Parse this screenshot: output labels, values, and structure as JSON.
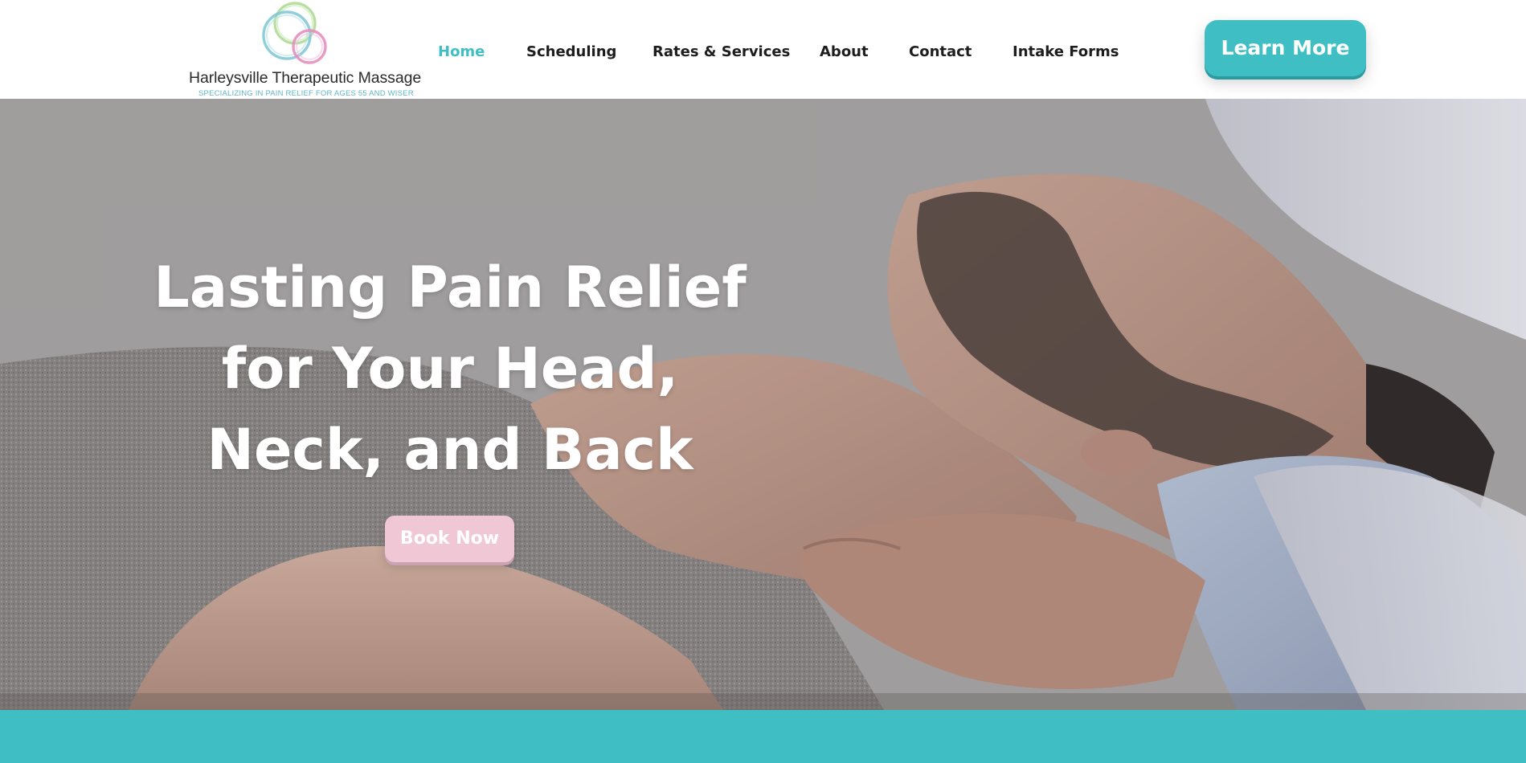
{
  "brand": {
    "name": "Harleysville Therapeutic Massage",
    "tagline": "SPECIALIZING IN PAIN RELIEF FOR AGES 55 AND WISER",
    "logo_icon": "overlapping-watercolor-rings-icon"
  },
  "nav": {
    "items": [
      {
        "label": "Home",
        "active": true
      },
      {
        "label": "Scheduling",
        "active": false
      },
      {
        "label": "Rates & Services",
        "active": false
      },
      {
        "label": "About",
        "active": false
      },
      {
        "label": "Contact",
        "active": false
      },
      {
        "label": "Intake Forms",
        "active": false
      }
    ],
    "cta_label": "Learn More"
  },
  "hero": {
    "title_lines": [
      "Lasting Pain Relief",
      "for Your Head,",
      "Neck, and Back"
    ],
    "cta_label": "Book Now",
    "image": "man-receiving-neck-massage-photo"
  },
  "colors": {
    "accent_teal": "#3fbfc3",
    "accent_pink": "#f0c8d5",
    "nav_text": "#1d1d1d",
    "ring_green": "#9fd38a",
    "ring_blue": "#7cc6d6",
    "ring_pink": "#e58fbf"
  }
}
